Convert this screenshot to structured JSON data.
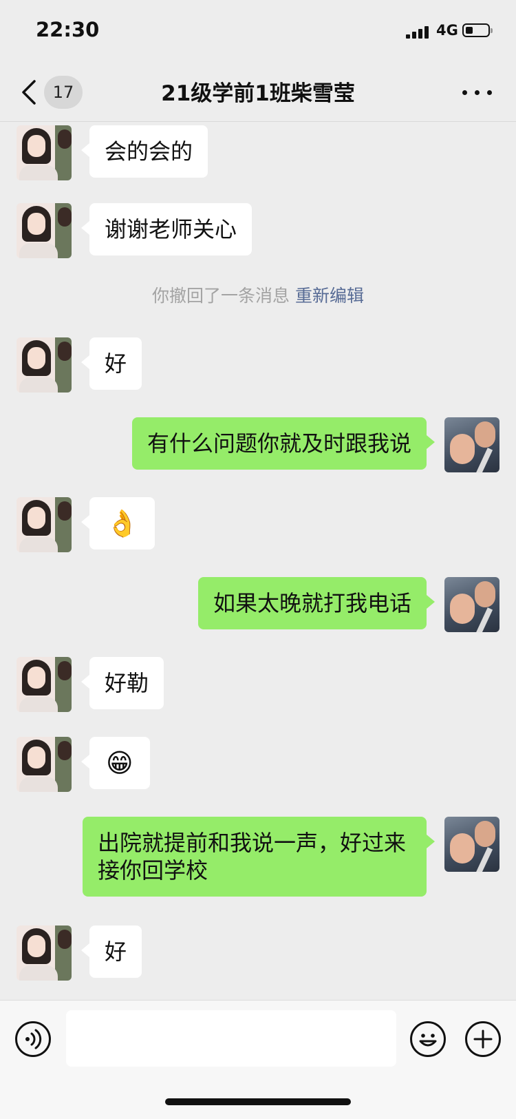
{
  "status_bar": {
    "time": "22:30",
    "network": "4G",
    "icons": [
      "signal-bars-icon",
      "battery-low-icon"
    ]
  },
  "nav": {
    "back_icon": "chevron-left-icon",
    "unread_badge": "17",
    "title": "21级学前1班柴雪莹",
    "more_icon": "ellipsis-icon"
  },
  "messages": [
    {
      "side": "in",
      "text": "会的会的"
    },
    {
      "side": "in",
      "text": "谢谢老师关心"
    },
    {
      "side": "system",
      "text": "你撤回了一条消息",
      "link": "重新编辑"
    },
    {
      "side": "in",
      "text": "好"
    },
    {
      "side": "out",
      "text": "有什么问题你就及时跟我说"
    },
    {
      "side": "in",
      "text": "👌",
      "emoji": "ok-hand-emoji"
    },
    {
      "side": "out",
      "text": "如果太晚就打我电话"
    },
    {
      "side": "in",
      "text": "好勒"
    },
    {
      "side": "in",
      "text": "😁",
      "emoji": "grinning-face-emoji"
    },
    {
      "side": "out",
      "text": "出院就提前和我说一声，好过来接你回学校"
    },
    {
      "side": "in",
      "text": "好"
    }
  ],
  "input_bar": {
    "voice_icon": "voice-icon",
    "text_value": "",
    "emoji_icon": "smiley-icon",
    "plus_icon": "plus-icon"
  },
  "colors": {
    "background": "#ededed",
    "outgoing_bubble": "#95ec69",
    "incoming_bubble": "#ffffff",
    "link": "#576b95"
  }
}
